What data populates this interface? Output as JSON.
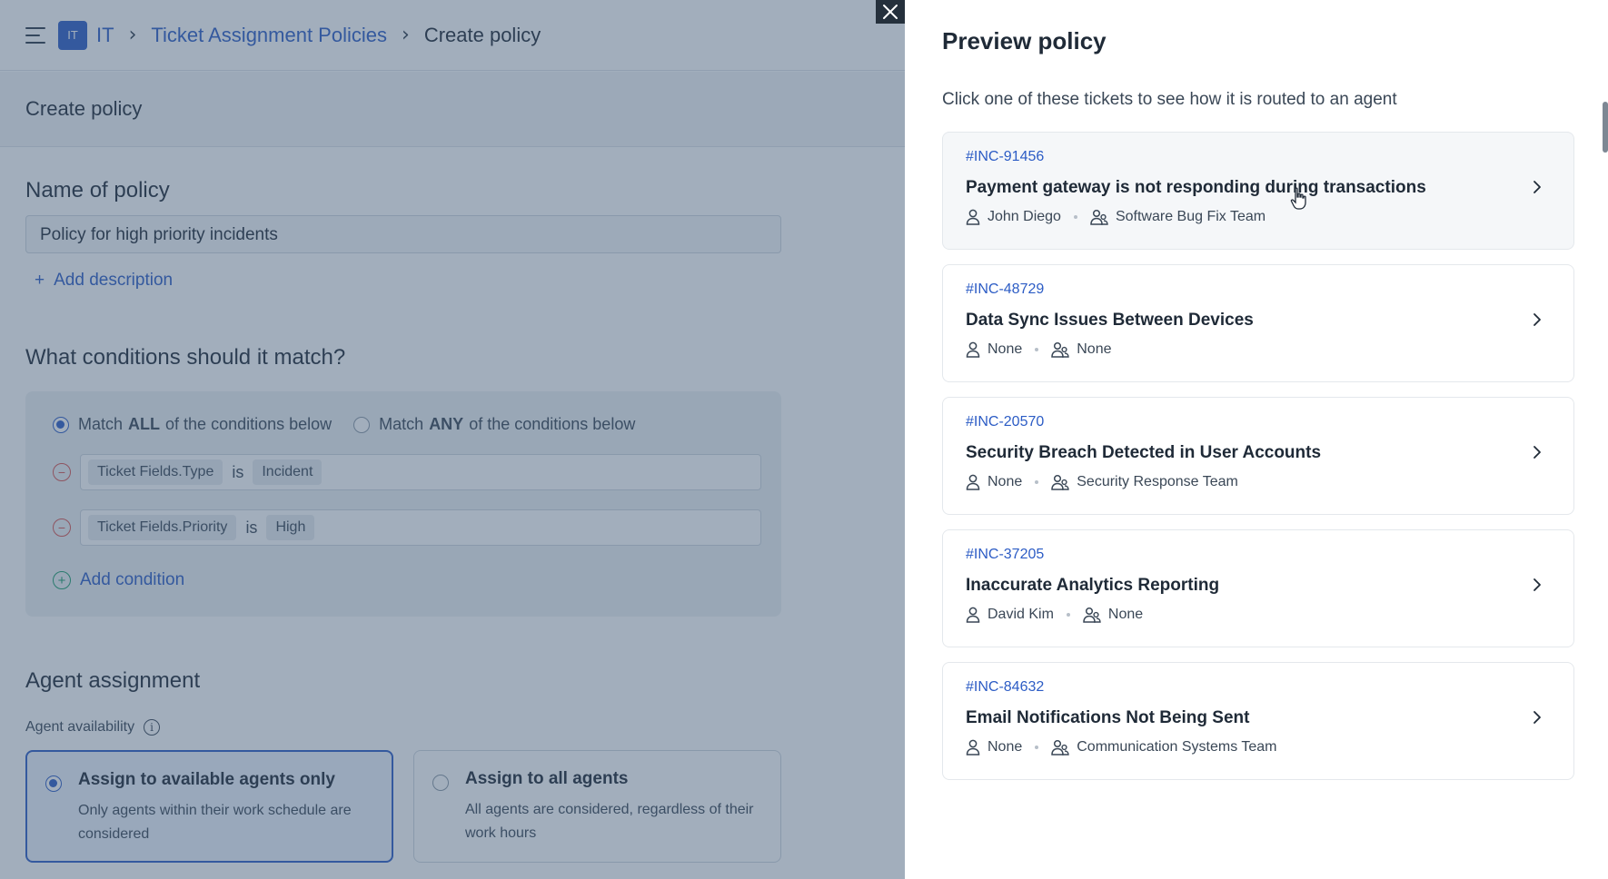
{
  "topbar": {
    "workspace_badge": "IT",
    "crumbs": [
      "IT",
      "Ticket Assignment Policies",
      "Create policy"
    ]
  },
  "subheader": {
    "title": "Create policy"
  },
  "policy": {
    "name_label": "Name of policy",
    "name_value": "Policy for high priority incidents",
    "add_description": "Add description"
  },
  "conditions": {
    "title": "What conditions should it match?",
    "match_all": {
      "pre": "Match",
      "key": "ALL",
      "post": "of the conditions below",
      "selected": true
    },
    "match_any": {
      "pre": "Match",
      "key": "ANY",
      "post": "of the conditions below",
      "selected": false
    },
    "rows": [
      {
        "field": "Ticket Fields.Type",
        "op": "is",
        "value": "Incident"
      },
      {
        "field": "Ticket Fields.Priority",
        "op": "is",
        "value": "High"
      }
    ],
    "add_condition": "Add condition"
  },
  "agent_assignment": {
    "title": "Agent assignment",
    "availability_label": "Agent availability",
    "options": [
      {
        "title": "Assign to available agents only",
        "desc": "Only agents within their work schedule are considered",
        "selected": true
      },
      {
        "title": "Assign to all agents",
        "desc": "All agents are considered, regardless of their work hours",
        "selected": false
      }
    ]
  },
  "preview": {
    "title": "Preview policy",
    "subtitle": "Click one of these tickets to see how it is routed to an agent",
    "tickets": [
      {
        "id": "#INC-91456",
        "title": "Payment gateway is not responding during transactions",
        "agent": "John Diego",
        "group": "Software Bug Fix Team"
      },
      {
        "id": "#INC-48729",
        "title": "Data Sync Issues Between Devices",
        "agent": "None",
        "group": "None"
      },
      {
        "id": "#INC-20570",
        "title": "Security Breach Detected in User Accounts",
        "agent": "None",
        "group": "Security Response Team"
      },
      {
        "id": "#INC-37205",
        "title": "Inaccurate Analytics Reporting",
        "agent": "David Kim",
        "group": "None"
      },
      {
        "id": "#INC-84632",
        "title": "Email Notifications Not Being Sent",
        "agent": "None",
        "group": "Communication Systems Team"
      }
    ]
  },
  "colors": {
    "accent": "#2c5cc5",
    "danger": "#d9534f",
    "success": "#1b9e6b",
    "overlay": "#3c5674"
  }
}
